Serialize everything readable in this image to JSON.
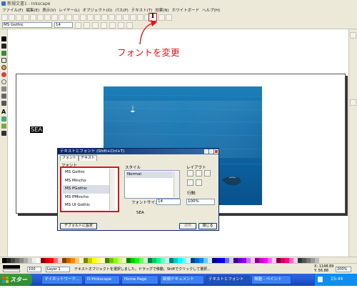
{
  "window": {
    "title": "新規文書1 - Inkscape"
  },
  "menubar": {
    "items": [
      "ファイル(F)",
      "編集(E)",
      "表示(V)",
      "レイヤー(L)",
      "オブジェクト(O)",
      "パス(P)",
      "テキスト(T)",
      "効果(N)",
      "ホワイトボード",
      "ヘルプ(H)"
    ]
  },
  "toolbar": {
    "text_tool_icon": "T"
  },
  "fontbar": {
    "font_family": "MS Gothic",
    "font_size": "14"
  },
  "annotation": {
    "label": "フォントを変更",
    "color": "#e0101c"
  },
  "canvas": {
    "sea_text": "SEA"
  },
  "dialog": {
    "title": "テキストとフォント (Shift+Ctrl+T)",
    "tabs": [
      "フォント",
      "テキスト"
    ],
    "font_label": "フォント",
    "style_label": "スタイル",
    "layout_label": "レイアウト",
    "fonts": [
      "MS Gothic",
      "MS Mincho",
      "MS PGothic",
      "MS PMincho",
      "MS UI Gothic"
    ],
    "selected_font": "MS PGothic",
    "style_selected": "Normal",
    "size_label": "フォントサイズ",
    "size_value": "14",
    "spacing_label": "行間:",
    "spacing_value": "100%",
    "preview": "SEA",
    "default_button": "デフォルトに設定",
    "apply_button": "適用",
    "close_button": "閉じる"
  },
  "statusbar": {
    "opacity": "100",
    "layer": "Layer 1",
    "message": "テキストオブジェクトを選択しました。ドラッグで移動、Shiftでクリックして選択...",
    "coord_x": "X: 1148.89",
    "coord_y": "Y: 56.88",
    "zoom": "200%"
  },
  "taskbar": {
    "start": "スタート",
    "buttons": [
      "マイネットワーク...",
      "D:¥Inkscape",
      "Home Page",
      "新規ドキュメント",
      "テキストとフォント",
      "無題 - ペイント"
    ],
    "clock": "15:44"
  }
}
